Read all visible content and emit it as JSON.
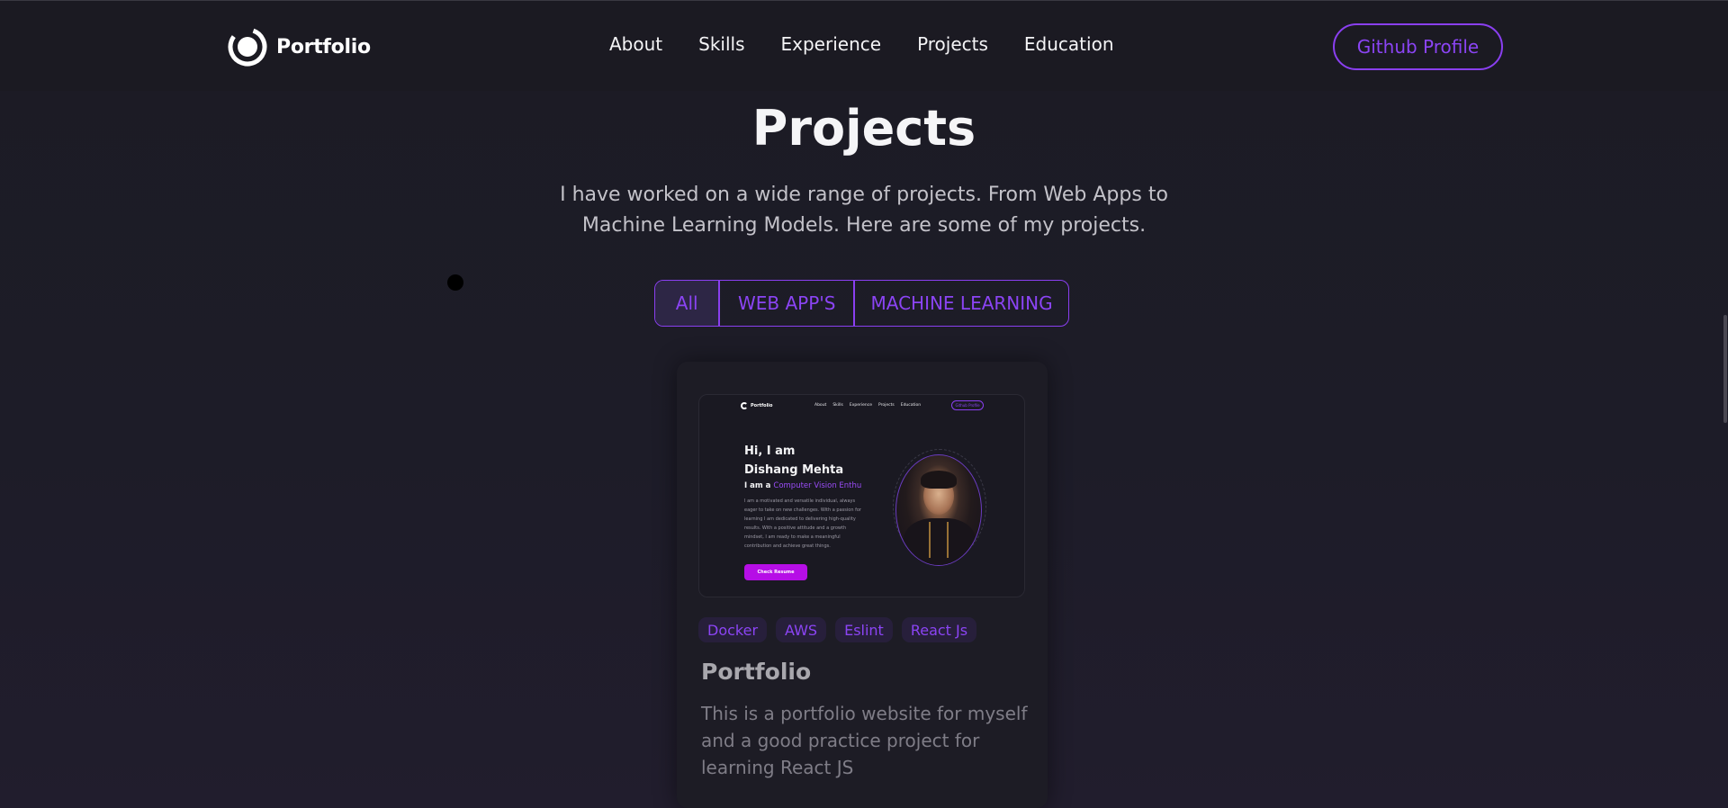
{
  "nav": {
    "brand": "Portfolio",
    "links": [
      "About",
      "Skills",
      "Experience",
      "Projects",
      "Education"
    ],
    "cta": "Github Profile"
  },
  "section": {
    "title": "Projects",
    "description": "I have worked on a wide range of projects. From Web Apps to Machine Learning Models. Here are some of my projects."
  },
  "filters": {
    "all": "All",
    "web": "WEB APP'S",
    "ml": "MACHINE LEARNING",
    "active": "All"
  },
  "project": {
    "preview": {
      "brand": "Portfolio",
      "links": [
        "About",
        "Skills",
        "Experience",
        "Projects",
        "Education"
      ],
      "cta": "Github Profile",
      "greeting": "Hi, I am",
      "name": "Dishang Mehta",
      "role_prefix": "I am a",
      "role": "Computer Vision Enthu",
      "bio": "I am a motivated and versatile individual, always eager to take on new challenges. With a passion for learning I am dedicated to delivering high-quality results. With a positive attitude and a growth mindset, I am ready to make a meaningful contribution and achieve great things.",
      "button": "Check Resume"
    },
    "tags": [
      "Docker",
      "AWS",
      "Eslint",
      "React Js"
    ],
    "title": "Portfolio",
    "description": "This is a portfolio website for myself and a good practice project for learning React JS"
  },
  "colors": {
    "accent": "#8b44f4",
    "background": "#1c1b24",
    "card": "#1d1c25",
    "resume_button": "#b60ee6"
  }
}
